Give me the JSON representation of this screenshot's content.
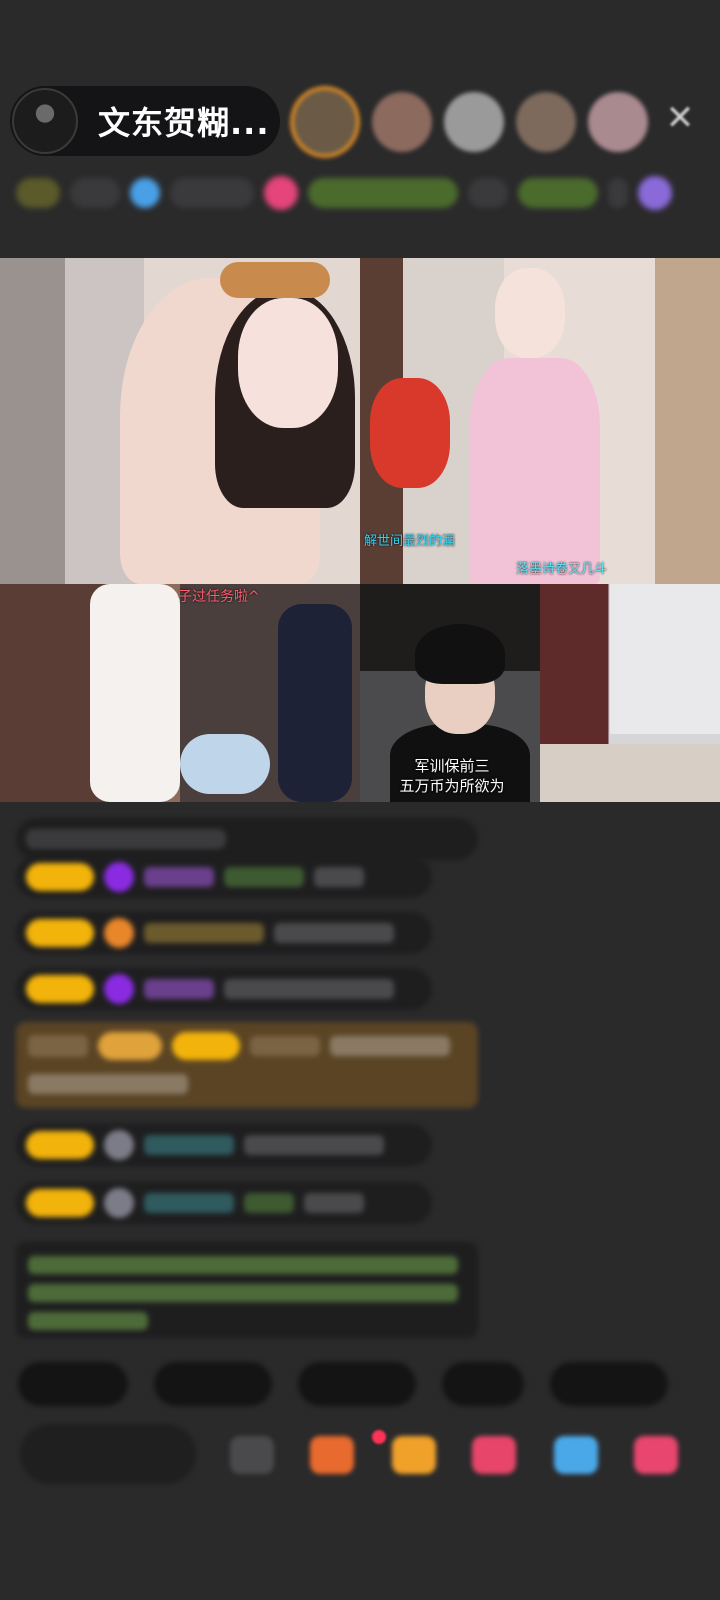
{
  "header": {
    "host_name": "文东贺糊...",
    "viewer_avatar_colors": [
      "#b9872f",
      "#8c6a5e",
      "#9a9a9a",
      "#7d6a5d",
      "#a98a8f"
    ],
    "close_label": "✕"
  },
  "video_grid": {
    "tile_b_caption_left": "解世间最烈的酒",
    "tile_b_caption_right": "落墨诗卷又几斗",
    "tile_c_caption": "子过任务啦^",
    "tile_d_caption_line1": "军训保前三",
    "tile_d_caption_line2": "五万币为所欲为"
  },
  "colors": {
    "background": "#2a2a2b",
    "badge_yellow": "#f2b30b",
    "gift_bg": "#5a4424",
    "notice_green": "#8fcf67"
  }
}
